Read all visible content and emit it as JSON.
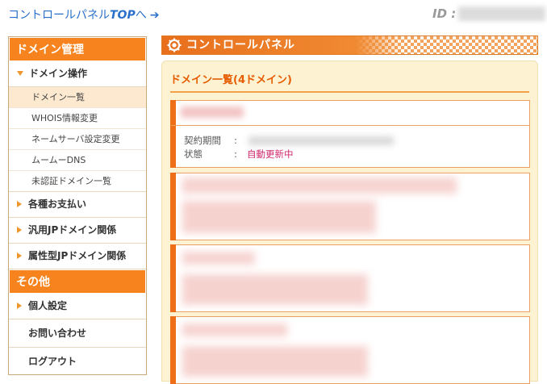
{
  "top": {
    "link_prefix": "コントロールパネル",
    "link_strong": "TOP",
    "link_suffix": "へ",
    "arrow": "➔",
    "id_label": "ID :"
  },
  "sidebar": {
    "domain_header": "ドメイン管理",
    "domain_ops": "ドメイン操作",
    "sub_items": [
      "ドメイン一覧",
      "WHOIS情報変更",
      "ネームサーバ設定変更",
      "ムームーDNS",
      "未認証ドメイン一覧"
    ],
    "payments": "各種お支払い",
    "general_jp": "汎用JPドメイン関係",
    "attr_jp": "属性型JPドメイン関係",
    "other_header": "その他",
    "personal": "個人設定",
    "contact": "お問い合わせ",
    "logout": "ログアウト"
  },
  "main": {
    "header_title": "コントロールパネル",
    "panel_title": "ドメイン一覧(4ドメイン)",
    "first_domain": {
      "contract_label": "契約期間",
      "status_label": "状態",
      "colon": ":",
      "status_value": "自動更新中"
    }
  },
  "colors": {
    "accent_orange": "#f7831e",
    "link_blue": "#2a6fc9",
    "status_pink": "#d0296d"
  }
}
